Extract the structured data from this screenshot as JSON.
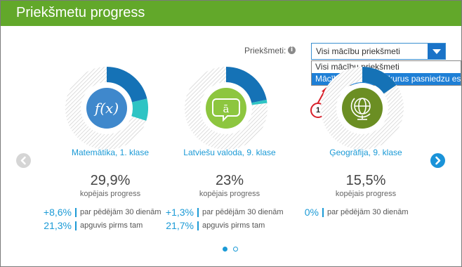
{
  "header": {
    "title": "Priekšmetu progress"
  },
  "filter": {
    "label": "Priekšmeti:",
    "info_icon": "i",
    "selected": "Visi mācību priekšmeti",
    "options": [
      "Visi mācību priekšmeti",
      "Mācību priekšmeti, kurus pasniedzu es"
    ]
  },
  "annotation": {
    "marker": "1",
    "color": "#d8202a"
  },
  "colors": {
    "header": "#62a82a",
    "accent": "#1b9ad6",
    "highlight": "#1e7fd6",
    "math": "#3f88cc",
    "latvian": "#8dc63f",
    "geo": "#6b8e23"
  },
  "subjects": [
    {
      "name": "Matemātika, 1. klase",
      "icon": "function-icon",
      "total": "29,9%",
      "total_label": "kopējais progress",
      "delta": "+8,6%",
      "delta_label": "par pēdējām 30 dienām",
      "prior": "21,3%",
      "prior_label": "apguvis pirms tam",
      "progress_fraction": 0.299,
      "recent_fraction": 0.086
    },
    {
      "name": "Latviešu valoda, 9. klase",
      "icon": "speech-bubble-icon",
      "total": "23%",
      "total_label": "kopējais progress",
      "delta": "+1,3%",
      "delta_label": "par pēdējām 30 dienām",
      "prior": "21,7%",
      "prior_label": "apguvis pirms tam",
      "progress_fraction": 0.23,
      "recent_fraction": 0.013
    },
    {
      "name": "Ģeogrāfija, 9. klase",
      "icon": "globe-icon",
      "total": "15,5%",
      "total_label": "kopējais progress",
      "delta": "0%",
      "delta_label": "par pēdējām 30 dienām",
      "progress_fraction": 0.155,
      "recent_fraction": 0.0
    }
  ],
  "carousel": {
    "pages": 2,
    "current": 1
  }
}
